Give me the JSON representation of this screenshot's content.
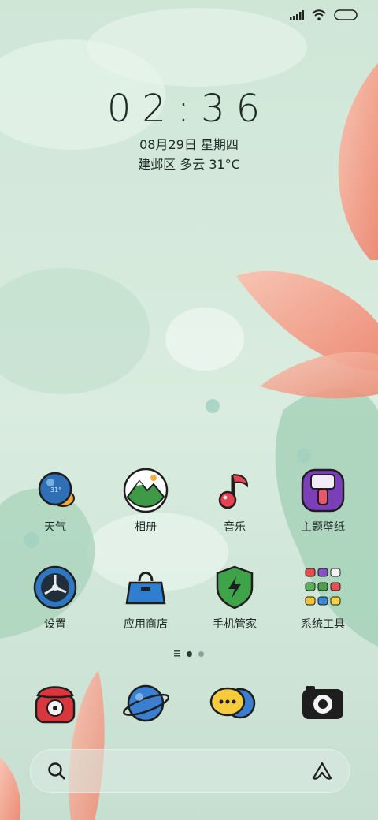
{
  "status_bar": {
    "icons": [
      "signal-icon",
      "wifi-icon",
      "battery-icon"
    ]
  },
  "lockscreen": {
    "time": "02:36",
    "date": "08月29日 星期四",
    "weather": "建邺区 多云 31°C"
  },
  "apps": [
    {
      "label": "天气",
      "icon": "weather-icon"
    },
    {
      "label": "相册",
      "icon": "gallery-icon"
    },
    {
      "label": "音乐",
      "icon": "music-icon"
    },
    {
      "label": "主题壁纸",
      "icon": "themes-icon"
    },
    {
      "label": "设置",
      "icon": "settings-icon"
    },
    {
      "label": "应用商店",
      "icon": "app-store-icon"
    },
    {
      "label": "手机管家",
      "icon": "security-icon"
    },
    {
      "label": "系统工具",
      "icon": "system-tools-folder-icon"
    }
  ],
  "page_indicator": {
    "pages": 2,
    "current": 1
  },
  "dock": [
    "phone-icon",
    "browser-icon",
    "messages-icon",
    "camera-icon"
  ],
  "search_bar": {
    "left_icon": "search-icon",
    "right_icon": "assistant-icon"
  },
  "colors": {
    "text": "#1f2a26",
    "petal": "#f2a08a",
    "leaf": "#a9d3bd"
  }
}
